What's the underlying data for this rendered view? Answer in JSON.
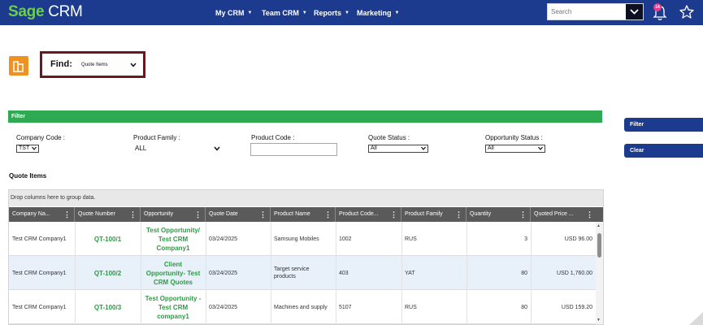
{
  "brand": {
    "name_primary": "Sage",
    "name_secondary": "CRM"
  },
  "nav": [
    {
      "label": "My CRM"
    },
    {
      "label": "Team CRM"
    },
    {
      "label": "Reports"
    },
    {
      "label": "Marketing"
    }
  ],
  "search": {
    "placeholder": "Search"
  },
  "notifications": {
    "count": "14"
  },
  "find": {
    "label": "Find:",
    "value": "Quote Items"
  },
  "filter": {
    "title": "Filter",
    "filter_button": "Filter",
    "clear_button": "Clear",
    "company_code": {
      "label": "Company Code :",
      "value": "TST"
    },
    "product_family": {
      "label": "Product Family :",
      "value": "ALL"
    },
    "product_code": {
      "label": "Product Code :",
      "value": ""
    },
    "quote_status": {
      "label": "Quote Status :",
      "value": "All"
    },
    "opportunity_status": {
      "label": "Opportunity Status :",
      "value": "All"
    }
  },
  "grid": {
    "title": "Quote Items",
    "group_hint": "Drop columns here to group data.",
    "columns": [
      "Company Na...",
      "Quote Number",
      "Opportunity",
      "Quote Date",
      "Product Name",
      "Product Code...",
      "Product Family",
      "Quantity",
      "Quoted Price ..."
    ],
    "rows": [
      {
        "company": "Test CRM Company1",
        "quote_number": "QT-100/1",
        "opportunity": "Test Opportunity/ Test CRM Company1",
        "quote_date": "03/24/2025",
        "product_name": "Samsung Mobiles",
        "product_code": "1002",
        "product_family": "RUS",
        "quantity": "3",
        "quoted_price": "USD 96.00"
      },
      {
        "company": "Test CRM Company1",
        "quote_number": "QT-100/2",
        "opportunity": "Client Opportunity- Test CRM Quotes",
        "quote_date": "03/24/2025",
        "product_name": "Target service products",
        "product_code": "403",
        "product_family": "YAT",
        "quantity": "80",
        "quoted_price": "USD 1,760.00"
      },
      {
        "company": "Test CRM Company1",
        "quote_number": "QT-100/3",
        "opportunity": "Test Opportunity - Test CRM company1",
        "quote_date": "03/24/2025",
        "product_name": "Machines and supply",
        "product_code": "5107",
        "product_family": "RUS",
        "quantity": "80",
        "quoted_price": "USD 159.20"
      }
    ]
  },
  "colors": {
    "topbar": "#1c3b8e",
    "brand_green": "#6ad04a",
    "filter_green": "#2eab52",
    "link_green": "#2e9b44",
    "find_border": "#6b1720",
    "entity_orange": "#f1911f",
    "header_gray": "#5a5a5a"
  }
}
